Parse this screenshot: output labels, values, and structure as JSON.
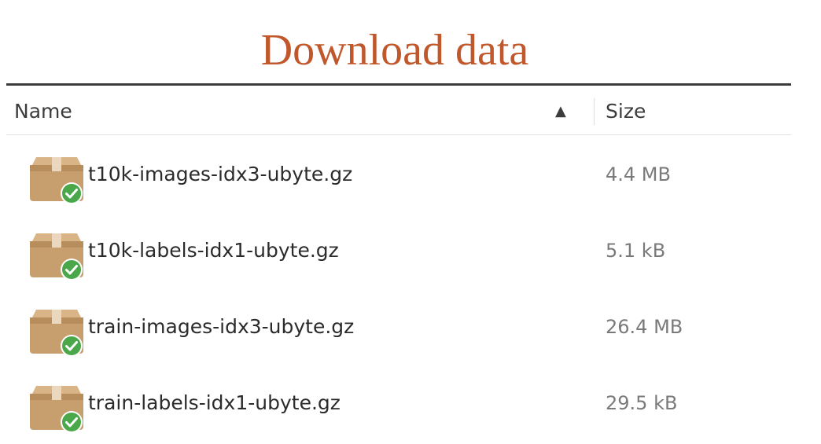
{
  "page": {
    "title": "Download data"
  },
  "file_list": {
    "columns": {
      "name": "Name",
      "sort_indicator": "▲",
      "size": "Size"
    },
    "files": [
      {
        "name": "t10k-images-idx3-ubyte.gz",
        "size": "4.4 MB",
        "icon": "package-icon",
        "status_icon": "check-badge-icon"
      },
      {
        "name": "t10k-labels-idx1-ubyte.gz",
        "size": "5.1 kB",
        "icon": "package-icon",
        "status_icon": "check-badge-icon"
      },
      {
        "name": "train-images-idx3-ubyte.gz",
        "size": "26.4 MB",
        "icon": "package-icon",
        "status_icon": "check-badge-icon"
      },
      {
        "name": "train-labels-idx1-ubyte.gz",
        "size": "29.5 kB",
        "icon": "package-icon",
        "status_icon": "check-badge-icon"
      }
    ]
  },
  "colors": {
    "title": "#c0582c",
    "package": "#c8a070",
    "check_badge": "#4aa84a"
  }
}
